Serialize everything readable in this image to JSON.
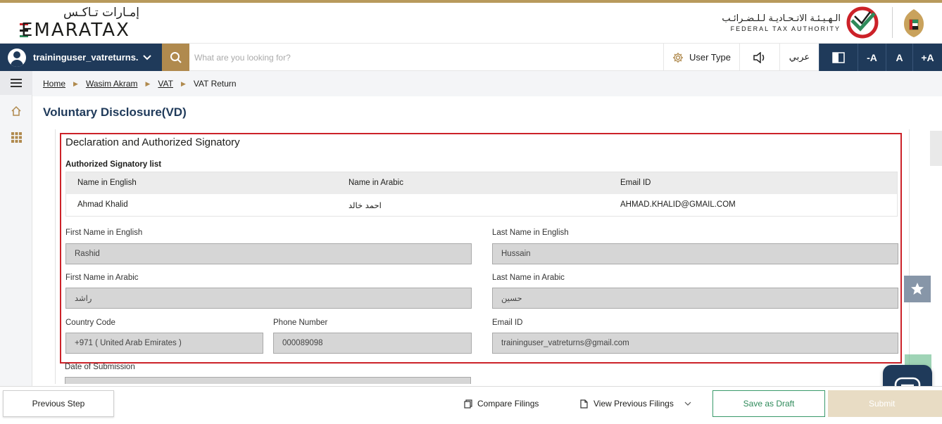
{
  "brand": {
    "name_ar": "إمـارات تـاكـس",
    "name_en": "EMARATAX",
    "stripe_colors": [
      "#cc2229",
      "#1d1d1b",
      "#2e8a5a"
    ]
  },
  "authority": {
    "name_ar": "الـهـيـئـة الاتـحـاديـة لـلـضـرائـب",
    "name_en": "FEDERAL TAX AUTHORITY"
  },
  "toolbar": {
    "user_name": "traininguser_vatreturns...",
    "search_placeholder": "What are you looking for?",
    "user_type_label": "User Type",
    "language_label": "عربي",
    "font_decrease": "-A",
    "font_normal": "A",
    "font_increase": "+A"
  },
  "breadcrumb": {
    "items": [
      "Home",
      "Wasim Akram",
      "VAT"
    ],
    "current": "VAT Return"
  },
  "page": {
    "title": "Voluntary Disclosure(VD)"
  },
  "declaration": {
    "title": "Declaration and Authorized Signatory",
    "list_title": "Authorized Signatory list",
    "columns": [
      "Name in English",
      "Name in Arabic",
      "Email ID"
    ],
    "rows": [
      {
        "name_en": "Ahmad Khalid",
        "name_ar": "احمد خالد",
        "email": "AHMAD.KHALID@GMAIL.COM"
      }
    ],
    "fields": {
      "first_name_en": {
        "label": "First Name in English",
        "value": "Rashid"
      },
      "last_name_en": {
        "label": "Last Name in English",
        "value": "Hussain"
      },
      "first_name_ar": {
        "label": "First Name in Arabic",
        "value": "راشد"
      },
      "last_name_ar": {
        "label": "Last Name in Arabic",
        "value": "حسين"
      },
      "country_code": {
        "label": "Country Code",
        "value": "+971 ( United Arab Emirates )"
      },
      "phone": {
        "label": "Phone Number",
        "value": "000089098"
      },
      "email": {
        "label": "Email ID",
        "value": "traininguser_vatreturns@gmail.com"
      }
    },
    "date_label": "Date of Submission"
  },
  "footer": {
    "previous_label": "Previous Step",
    "compare_label": "Compare Filings",
    "view_previous_label": "View Previous Filings",
    "save_draft_label": "Save as Draft",
    "submit_label": "Submit"
  },
  "colors": {
    "navy": "#1f3a5a",
    "gold": "#b08a4e",
    "highlight_red": "#cc2229",
    "green": "#2e8a5a"
  }
}
